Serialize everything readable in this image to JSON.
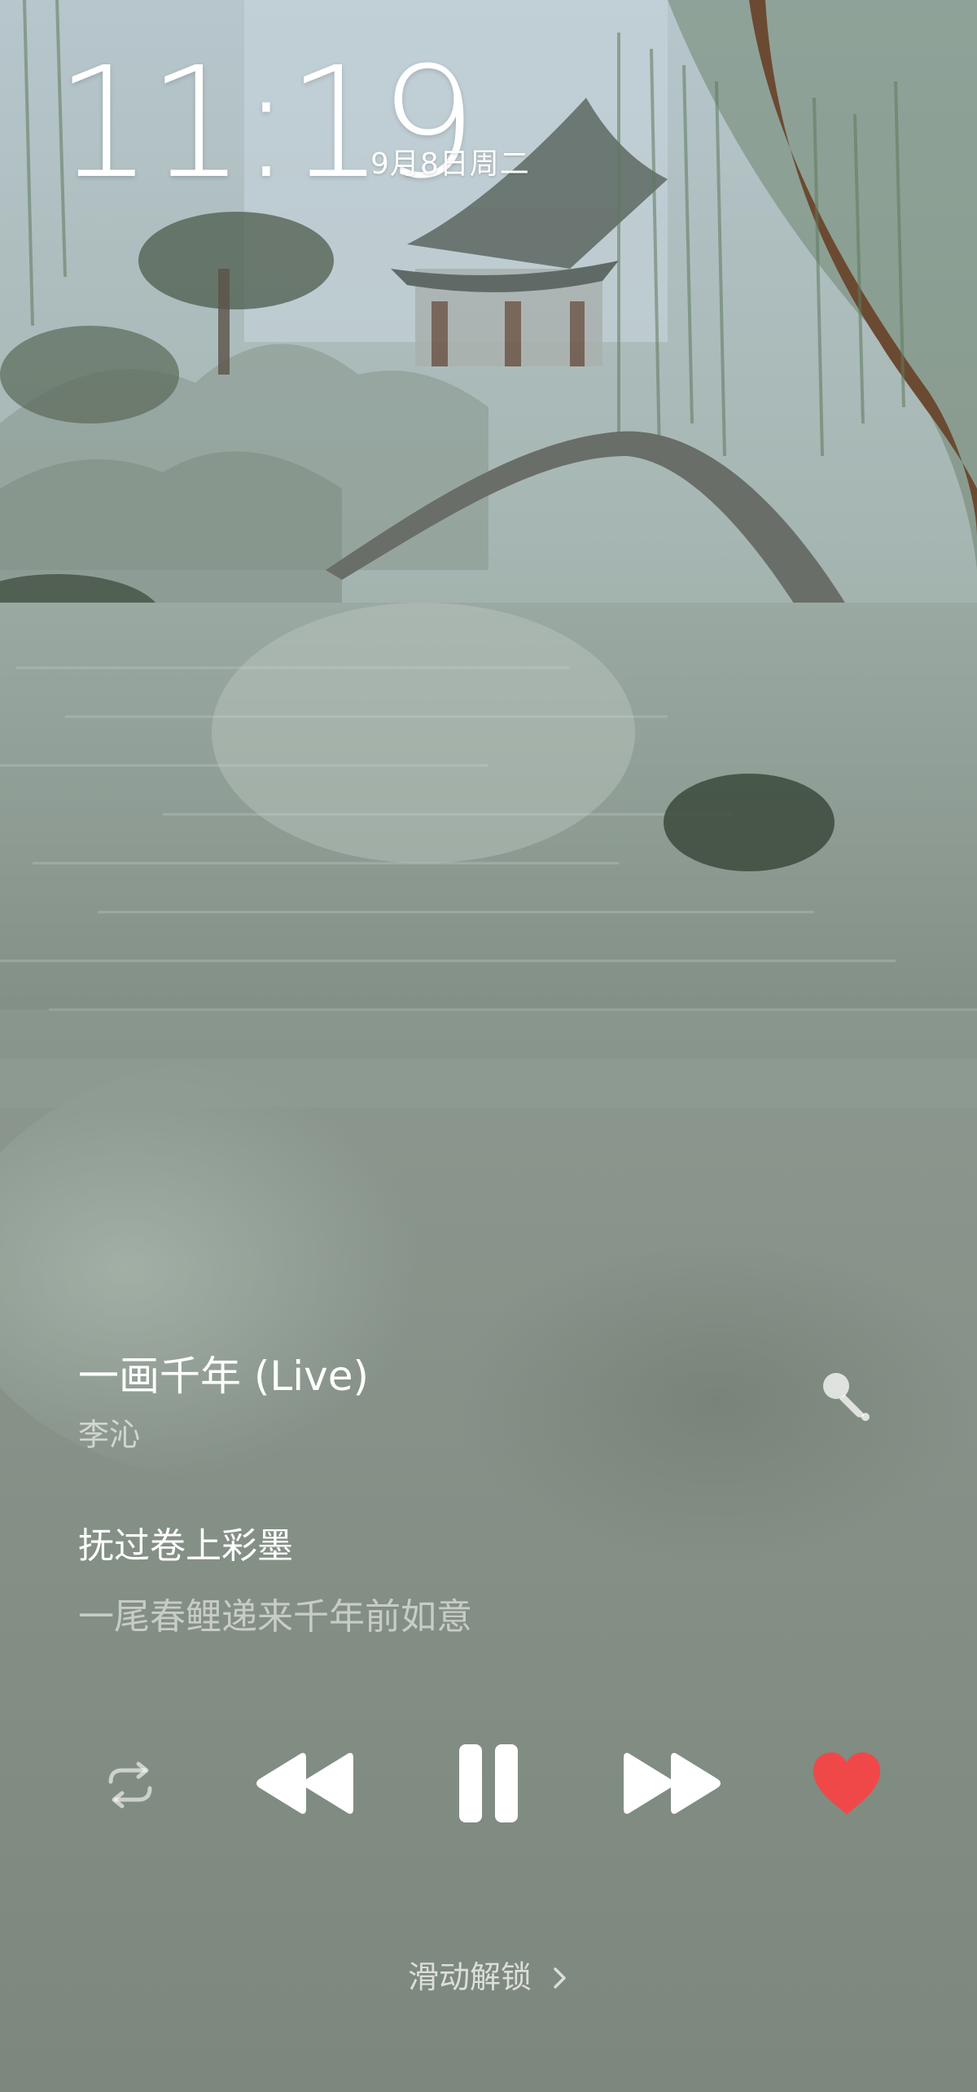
{
  "lockscreen": {
    "time": "11:19",
    "date": "9月8日周二",
    "unlock_hint": "滑动解锁"
  },
  "player": {
    "title": "一画千年 (Live)",
    "artist": "李沁",
    "lyric_current": "抚过卷上彩墨",
    "lyric_next": "一尾春鲤递来千年前如意",
    "liked": true,
    "playing": true
  },
  "icons": {
    "mic": "microphone-icon",
    "repeat": "repeat-icon",
    "prev": "previous-track-icon",
    "pause": "pause-icon",
    "next": "next-track-icon",
    "like": "heart-icon",
    "chevron": "chevron-right-icon"
  },
  "colors": {
    "like_active": "#f04848",
    "text_primary": "#ffffff"
  }
}
